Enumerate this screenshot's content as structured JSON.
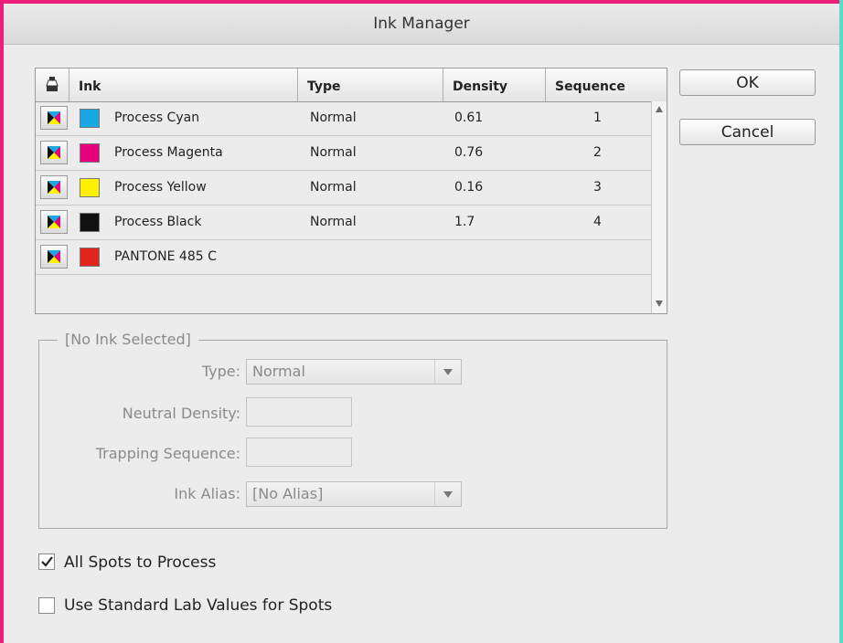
{
  "dialog": {
    "title": "Ink Manager"
  },
  "table": {
    "headers": {
      "ink": "Ink",
      "type": "Type",
      "density": "Density",
      "sequence": "Sequence"
    },
    "rows": [
      {
        "name": "Process Cyan",
        "type": "Normal",
        "density": "0.61",
        "sequence": "1",
        "color": "#1aa7e6"
      },
      {
        "name": "Process Magenta",
        "type": "Normal",
        "density": "0.76",
        "sequence": "2",
        "color": "#e6007e"
      },
      {
        "name": "Process Yellow",
        "type": "Normal",
        "density": "0.16",
        "sequence": "3",
        "color": "#fff200"
      },
      {
        "name": "Process Black",
        "type": "Normal",
        "density": "1.7",
        "sequence": "4",
        "color": "#111111"
      },
      {
        "name": "PANTONE 485 C",
        "type": "",
        "density": "",
        "sequence": "",
        "color": "#e1251b"
      }
    ]
  },
  "buttons": {
    "ok": "OK",
    "cancel": "Cancel"
  },
  "ink_settings": {
    "legend": "[No Ink Selected]",
    "type_label": "Type:",
    "type_value": "Normal",
    "neutral_density_label": "Neutral Density:",
    "neutral_density_value": "",
    "trapping_sequence_label": "Trapping Sequence:",
    "trapping_sequence_value": "",
    "ink_alias_label": "Ink Alias:",
    "ink_alias_value": "[No Alias]"
  },
  "options": {
    "all_spots_to_process": {
      "label": "All Spots to Process",
      "checked": true
    },
    "use_standard_lab": {
      "label": "Use Standard Lab Values for Spots",
      "checked": false
    }
  },
  "colors": {
    "window_border": "#ee1e7e",
    "background": "#5fd9c8"
  }
}
